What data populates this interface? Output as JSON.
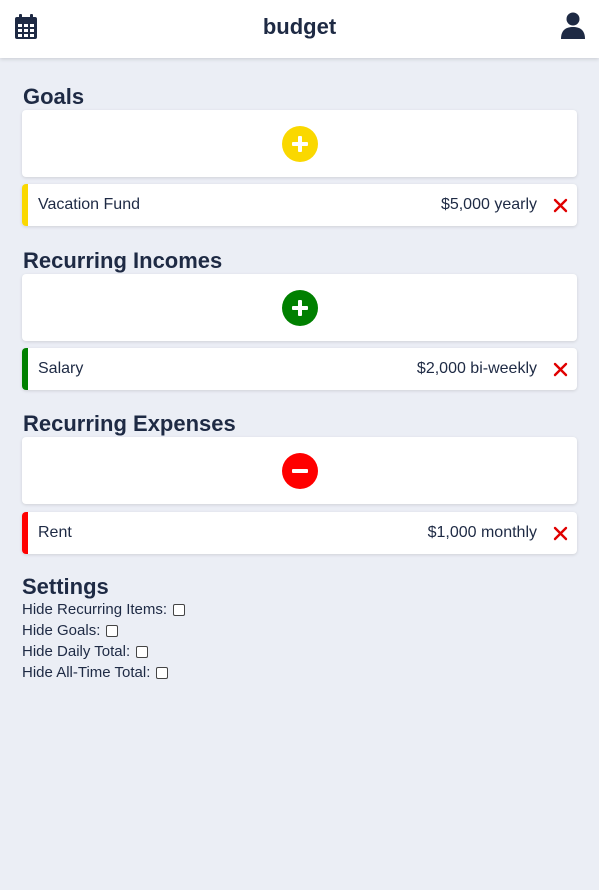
{
  "app": {
    "title": "budget"
  },
  "colors": {
    "goal": "#fad800",
    "income": "#008000",
    "expense": "#ff0000",
    "delete": "#e00000"
  },
  "sections": {
    "goals": {
      "title": "Goals",
      "add_icon": "plus-icon",
      "items": [
        {
          "name": "Vacation Fund",
          "amount": "$5,000 yearly"
        }
      ]
    },
    "incomes": {
      "title": "Recurring Incomes",
      "add_icon": "plus-icon",
      "items": [
        {
          "name": "Salary",
          "amount": "$2,000 bi-weekly"
        }
      ]
    },
    "expenses": {
      "title": "Recurring Expenses",
      "add_icon": "minus-icon",
      "items": [
        {
          "name": "Rent",
          "amount": "$1,000 monthly"
        }
      ]
    }
  },
  "settings": {
    "title": "Settings",
    "options": [
      {
        "label": "Hide Recurring Items:",
        "checked": false
      },
      {
        "label": "Hide Goals:",
        "checked": false
      },
      {
        "label": "Hide Daily Total:",
        "checked": false
      },
      {
        "label": "Hide All-Time Total:",
        "checked": false
      }
    ]
  }
}
